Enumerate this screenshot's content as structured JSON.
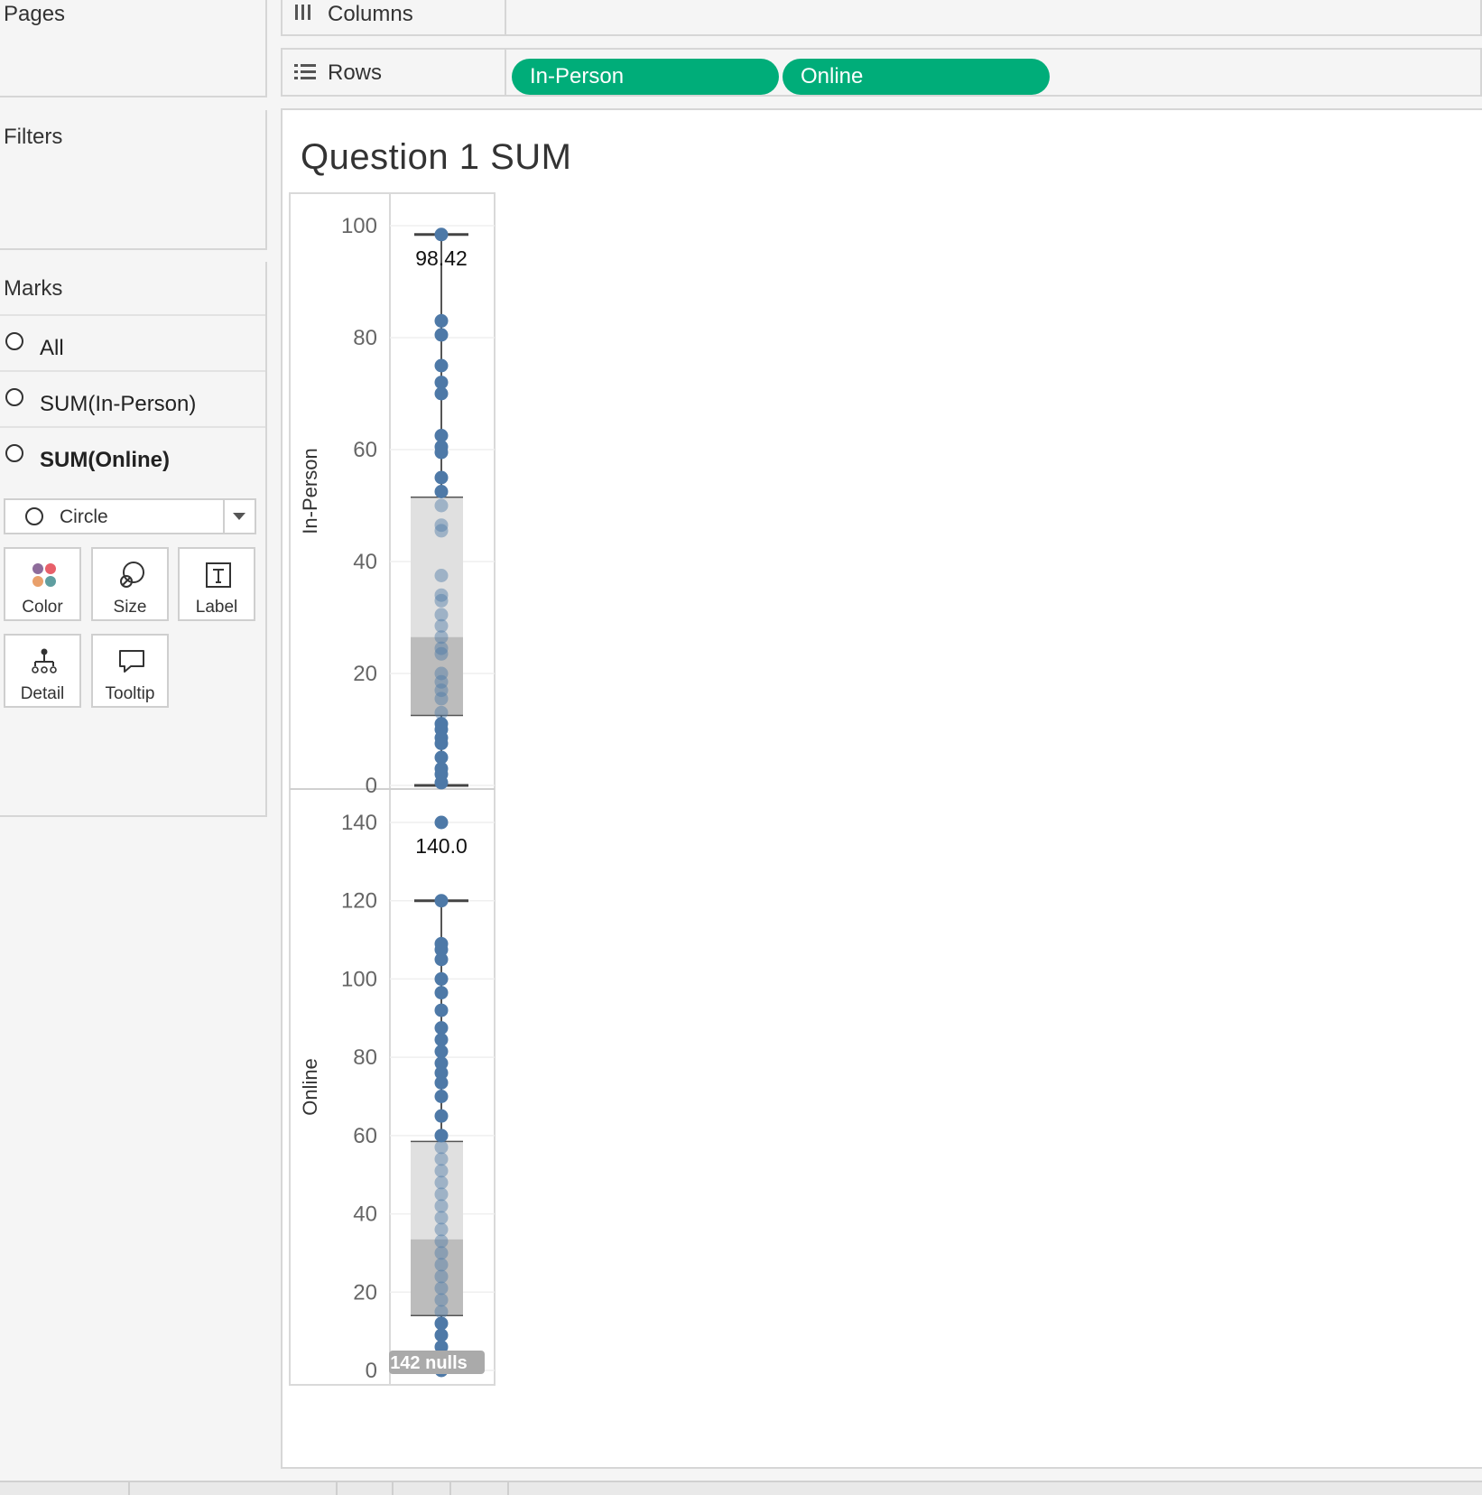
{
  "pages": {
    "title": "Pages"
  },
  "filters": {
    "title": "Filters"
  },
  "marks": {
    "title": "Marks",
    "items": [
      {
        "label": "All",
        "bold": false
      },
      {
        "label": "SUM(In-Person)",
        "bold": false
      },
      {
        "label": "SUM(Online)",
        "bold": true
      }
    ],
    "mark_type": "Circle",
    "buttons": [
      {
        "label": "Color",
        "icon": "color-icon"
      },
      {
        "label": "Size",
        "icon": "size-icon"
      },
      {
        "label": "Label",
        "icon": "label-icon"
      },
      {
        "label": "Detail",
        "icon": "detail-icon"
      },
      {
        "label": "Tooltip",
        "icon": "tooltip-icon"
      }
    ]
  },
  "shelves": {
    "columns_label": "Columns",
    "rows_label": "Rows",
    "row_pills": [
      "In-Person",
      "Online"
    ]
  },
  "colors": {
    "pill": "#00ad79",
    "dot": "#4e79a7",
    "box_upper": "#e0e0e0",
    "box_lower": "#bcbcbc"
  },
  "viz": {
    "title": "Question 1 SUM"
  },
  "chart_data": [
    {
      "type": "scatter",
      "subtype": "box-plot with jittered dots",
      "ylabel": "In-Person",
      "ylim": [
        0,
        100
      ],
      "yticks": [
        "100",
        "80",
        "60",
        "40",
        "20",
        "0"
      ],
      "box": {
        "whisker_low": 0,
        "q1": 12.5,
        "median": 26.5,
        "q3": 51.5,
        "whisker_high": 98.42
      },
      "annotation": "98.42",
      "values": [
        98.42,
        83,
        80.5,
        75,
        72,
        70,
        62.5,
        60.5,
        59.5,
        55,
        52.5,
        50,
        46.5,
        45.5,
        37.5,
        34,
        33,
        30.5,
        28.5,
        26.5,
        24.5,
        23.5,
        20,
        18.5,
        17,
        15.5,
        13,
        11,
        10,
        8.5,
        7.5,
        5,
        3,
        2,
        0.5
      ]
    },
    {
      "type": "scatter",
      "subtype": "box-plot with jittered dots",
      "ylabel": "Online",
      "ylim": [
        0,
        140
      ],
      "yticks": [
        "140",
        "120",
        "100",
        "80",
        "60",
        "40",
        "20",
        "0"
      ],
      "box": {
        "whisker_low": 0,
        "q1": 14,
        "median": 33.5,
        "q3": 58.5,
        "whisker_high": 120
      },
      "annotation": "140.0",
      "nulls_label": "142 nulls",
      "values": [
        140,
        120,
        109,
        107.5,
        105,
        100,
        96.5,
        92,
        87.5,
        84.5,
        81.5,
        78.5,
        76,
        73.5,
        70,
        65,
        60,
        57,
        54,
        51,
        48,
        45,
        42,
        39,
        36,
        33,
        30,
        27,
        24,
        21,
        18,
        15,
        12,
        9,
        6,
        3,
        0
      ]
    }
  ]
}
